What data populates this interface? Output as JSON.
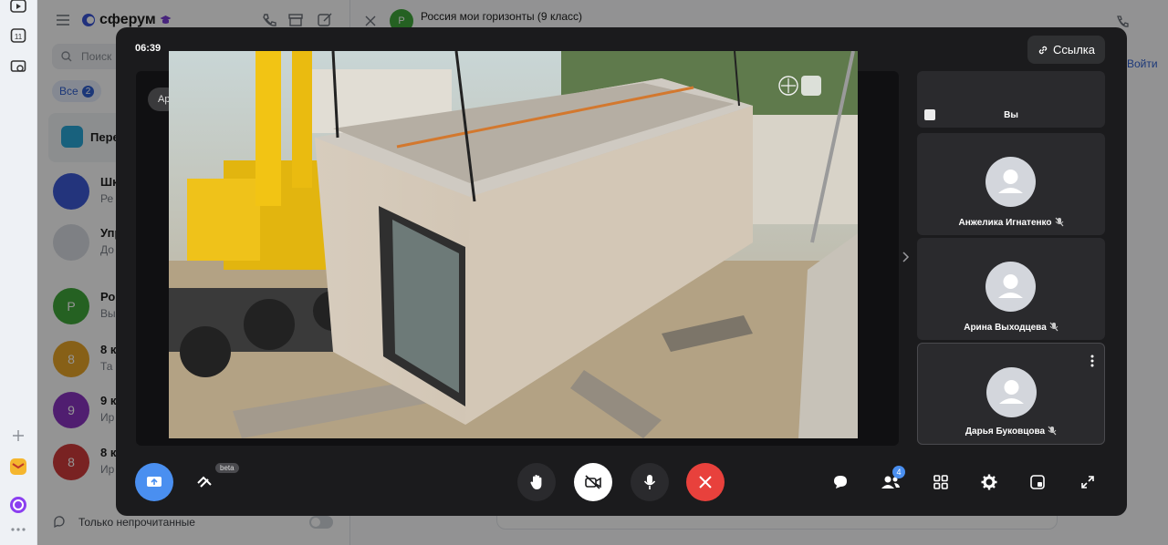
{
  "sidebar": {
    "brand": "сферум",
    "search_placeholder": "Поиск",
    "all_tab": "Все",
    "all_badge": "2",
    "pinned_label": "Пере",
    "chats": [
      {
        "title": "Шк",
        "sub": "Ре",
        "avatar_color": "#3d5ad6",
        "avatar_text": ""
      },
      {
        "title": "Упр",
        "sub": "До",
        "avatar_color": "#d9dde3",
        "avatar_text": ""
      },
      {
        "title": "Ро",
        "sub": "Вы",
        "avatar_color": "#41a83b",
        "avatar_text": "Р"
      },
      {
        "title": "8 к",
        "sub": "Та",
        "avatar_color": "#e9a528",
        "avatar_text": "8"
      },
      {
        "title": "9 к",
        "sub": "Ир",
        "avatar_color": "#8a35c2",
        "avatar_text": "9"
      },
      {
        "title": "8 к",
        "sub": "Ир",
        "avatar_color": "#d03b3b",
        "avatar_text": "8"
      }
    ],
    "unread_only": "Только непрочитанные"
  },
  "chat_header": {
    "title": "Россия мои горизонты (9 класс)",
    "avatar_text": "Р",
    "join_label": "Войти"
  },
  "call": {
    "timer": "06:39",
    "link_label": "Ссылка",
    "presenter_tag": "Ар",
    "beta_label": "beta",
    "participants_badge": "4",
    "participants": [
      {
        "name": "Вы",
        "self": true
      },
      {
        "name": "Анжелика Игнатенко",
        "muted": true
      },
      {
        "name": "Арина Выходцева",
        "muted": true
      },
      {
        "name": "Дарья Буковцова",
        "muted": true
      }
    ]
  },
  "colors": {
    "accent_blue": "#4a8ff0",
    "end_call_red": "#e8413c",
    "modal_bg": "#1b1b1d"
  }
}
